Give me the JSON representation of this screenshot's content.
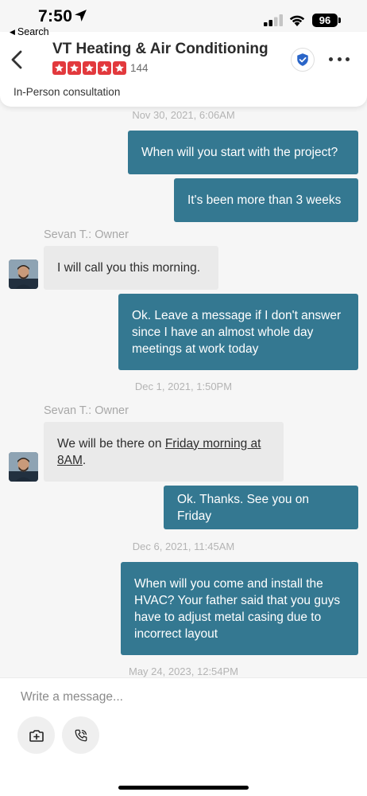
{
  "status_bar": {
    "time": "7:50",
    "back_label": "Search",
    "battery": "96"
  },
  "header": {
    "title": "VT Heating & Air Conditioning",
    "rating": 5,
    "review_count": "144",
    "subtitle": "In-Person consultation",
    "star_color": "#e2393d",
    "verified_color": "#2a65c8"
  },
  "messages": [
    {
      "type": "timestamp",
      "text": "Nov 30, 2021, 6:06AM"
    },
    {
      "type": "outgoing",
      "text": "When will you start with the project?"
    },
    {
      "type": "outgoing",
      "text": "It's been more than 3 weeks"
    },
    {
      "type": "sender",
      "text": "Sevan T.: Owner"
    },
    {
      "type": "incoming",
      "text": "I will call you this morning."
    },
    {
      "type": "outgoing",
      "text": "Ok. Leave a message if I don't answer since I have an almost whole day meetings at work today"
    },
    {
      "type": "timestamp",
      "text": "Dec 1, 2021, 1:50PM"
    },
    {
      "type": "sender",
      "text": "Sevan T.: Owner"
    },
    {
      "type": "incoming",
      "text_before": "We will be there on ",
      "link_text": "Friday morning at 8AM",
      "text_after": "."
    },
    {
      "type": "outgoing",
      "text": "Ok. Thanks. See you on Friday"
    },
    {
      "type": "timestamp",
      "text": "Dec 6, 2021, 11:45AM"
    },
    {
      "type": "outgoing",
      "text": "When will you come and install the HVAC? Your father said that you guys have to adjust metal casing due to incorrect layout"
    },
    {
      "type": "timestamp",
      "text": "May 24, 2023, 12:54PM"
    }
  ],
  "composer": {
    "placeholder": "Write a message...",
    "left_button": "camera-icon",
    "right_button": "phone-icon"
  },
  "colors": {
    "outgoing_bubble": "#347891",
    "incoming_bubble": "#eaeaea",
    "background": "#f6f6f6"
  }
}
